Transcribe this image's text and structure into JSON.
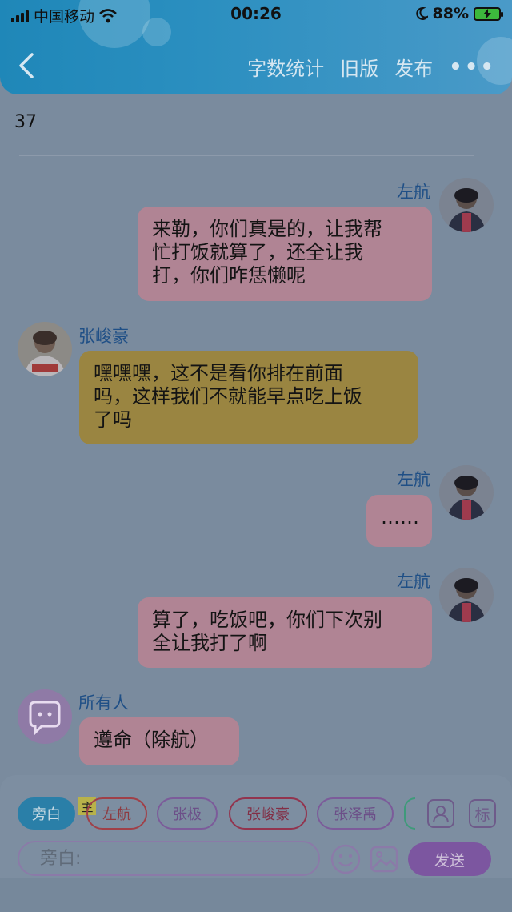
{
  "status": {
    "carrier": "中国移动",
    "time": "00:26",
    "battery": "88%"
  },
  "nav": {
    "actions": [
      "字数统计",
      "旧版",
      "发布"
    ],
    "more": "•••"
  },
  "word_count": "37",
  "messages": [
    {
      "name": "左航",
      "text_lines": [
        "来勒，你们真是的，让我帮",
        "忙打饭就算了，还全让我",
        "打，你们咋恁懒呢"
      ]
    },
    {
      "name": "张峻豪",
      "text_lines": [
        "嘿嘿嘿，这不是看你排在前面",
        "吗，这样我们不就能早点吃上饭",
        "了吗"
      ]
    },
    {
      "name": "左航",
      "text_lines": [
        "……"
      ]
    },
    {
      "name": "左航",
      "text_lines": [
        "算了，吃饭吧，你们下次别",
        "全让我打了啊"
      ]
    },
    {
      "name": "所有人",
      "text_lines": [
        "遵命（除航）"
      ]
    }
  ],
  "chips": {
    "active": "旁白",
    "badge": "主",
    "items": [
      "左航",
      "张极",
      "张峻豪",
      "张泽禹"
    ]
  },
  "side_icons": {
    "person": "person-card-icon",
    "label": "标"
  },
  "input": {
    "placeholder": "旁白:"
  },
  "send": "发送"
}
